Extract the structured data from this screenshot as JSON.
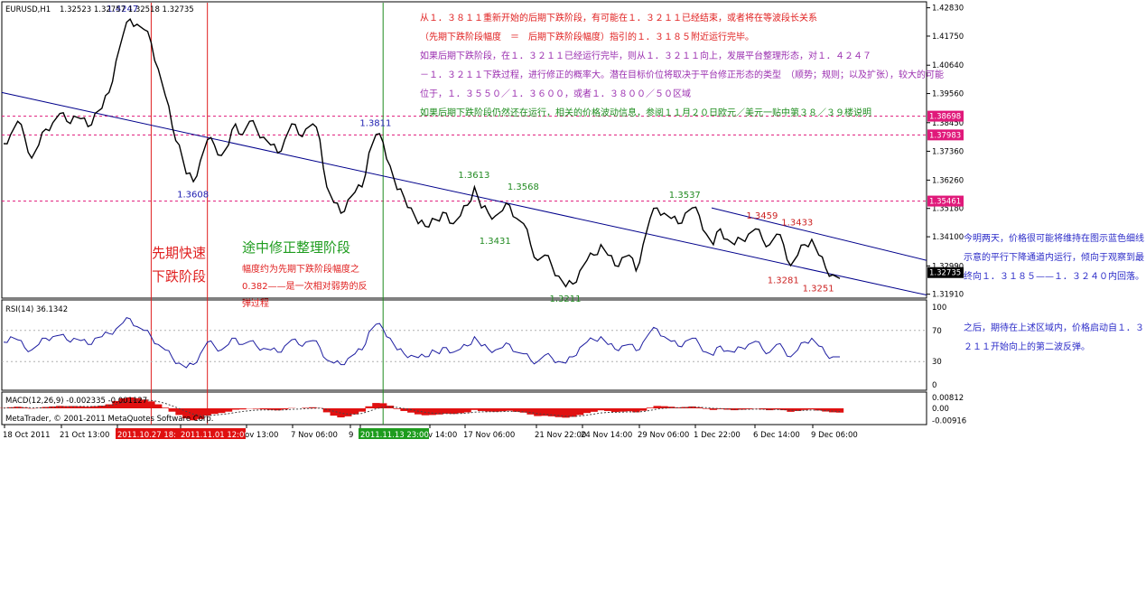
{
  "header": {
    "symbol": "EURUSD,H1",
    "ohlc": "1.32523 1.32757 1.32518 1.32735"
  },
  "chart_data": [
    {
      "type": "line",
      "title": "EURUSD,H1",
      "ylim": [
        1.3183,
        1.4292
      ],
      "y_ticks": [
        "1.42830",
        "1.41750",
        "1.40640",
        "1.39560",
        "1.38450",
        "1.37360",
        "1.36260",
        "1.35180",
        "1.34100",
        "1.32990",
        "1.31910"
      ],
      "price_tags": [
        {
          "label": "1.38698",
          "value": 1.38698,
          "color": "#e0197a"
        },
        {
          "label": "1.37983",
          "value": 1.37983,
          "color": "#e0197a"
        },
        {
          "label": "1.35461",
          "value": 1.35461,
          "color": "#e0197a"
        },
        {
          "label": "1.32735",
          "value": 1.32735,
          "color": "#000000"
        }
      ],
      "x_ticks": [
        "18 Oct 2011",
        "21 Oct 13:00",
        "2011.10.27 18:",
        "2011.11.01 12:00",
        "ov 13:00",
        "7 Nov 06:00",
        "9",
        "2011.11.13 23:00",
        "v 14:00",
        "17 Nov 06:00",
        "21 Nov 22:00",
        "24 Nov 14:00",
        "29 Nov 06:00",
        "1 Dec 22:00",
        "6 Dec 14:00",
        "9 Dec 06:00"
      ],
      "series": [
        {
          "color": "#000000",
          "values": [
            1.3765,
            1.38,
            1.385,
            1.379,
            1.371,
            1.376,
            1.382,
            1.3845,
            1.388,
            1.385,
            1.387,
            1.386,
            1.383,
            1.388,
            1.39,
            1.396,
            1.408,
            1.418,
            1.424,
            1.422,
            1.42,
            1.415,
            1.405,
            1.395,
            1.383,
            1.376,
            1.365,
            1.362,
            1.37,
            1.378,
            1.376,
            1.372,
            1.376,
            1.384,
            1.38,
            1.385,
            1.382,
            1.379,
            1.376,
            1.373,
            1.378,
            1.384,
            1.38,
            1.382,
            1.384,
            1.378,
            1.36,
            1.354,
            1.35,
            1.355,
            1.358,
            1.36,
            1.373,
            1.38,
            1.377,
            1.368,
            1.359,
            1.356,
            1.352,
            1.346,
            1.345,
            1.348,
            1.347,
            1.35,
            1.346,
            1.349,
            1.353,
            1.36,
            1.352,
            1.35,
            1.349,
            1.351,
            1.353,
            1.348,
            1.346,
            1.338,
            1.332,
            1.334,
            1.33,
            1.326,
            1.322,
            1.323,
            1.328,
            1.332,
            1.334,
            1.338,
            1.334,
            1.33,
            1.333,
            1.334,
            1.328,
            1.338,
            1.348,
            1.352,
            1.35,
            1.348,
            1.346,
            1.35,
            1.352,
            1.349,
            1.342,
            1.338,
            1.344,
            1.34,
            1.338,
            1.34,
            1.342,
            1.344,
            1.34,
            1.338,
            1.342,
            1.338,
            1.33,
            1.334,
            1.338,
            1.34,
            1.334,
            1.329,
            1.3265,
            1.3251
          ]
        }
      ],
      "trendlines": [
        {
          "name": "channel-lower",
          "color": "#00008b",
          "points": [
            [
              0,
              1.396
            ],
            [
              1024,
              1.3188
            ]
          ]
        },
        {
          "name": "channel-upper",
          "color": "#00008b",
          "points": [
            [
              786,
              1.352
            ],
            [
              1024,
              1.332
            ]
          ]
        }
      ],
      "annotations": [
        {
          "text": "1.4247",
          "color": "#1c1cb0",
          "value": 1.4247,
          "index": 17
        },
        {
          "text": "1.3608",
          "color": "#1c1cb0",
          "value": 1.3608,
          "index": 27
        },
        {
          "text": "1.3811",
          "color": "#1c1cb0",
          "value": 1.3811,
          "index": 53
        },
        {
          "text": "1.3613",
          "color": "#228b22",
          "value": 1.3613,
          "index": 67
        },
        {
          "text": "1.3568",
          "color": "#228b22",
          "value": 1.3568,
          "index": 74
        },
        {
          "text": "1.3431",
          "color": "#228b22",
          "value": 1.3431,
          "index": 70
        },
        {
          "text": "1.3211",
          "color": "#228b22",
          "value": 1.3211,
          "index": 80
        },
        {
          "text": "1.3537",
          "color": "#228b22",
          "value": 1.3537,
          "index": 97
        },
        {
          "text": "1.3459",
          "color": "#cc2222",
          "value": 1.3459,
          "index": 108
        },
        {
          "text": "1.3433",
          "color": "#cc2222",
          "value": 1.3433,
          "index": 113
        },
        {
          "text": "1.3281",
          "color": "#cc2222",
          "value": 1.3281,
          "index": 111
        },
        {
          "text": "1.3251",
          "color": "#cc2222",
          "value": 1.3251,
          "index": 116
        }
      ],
      "vertical_markers": [
        {
          "name": "marker-1",
          "color": "#e02020",
          "index": 21
        },
        {
          "name": "marker-2",
          "color": "#e02020",
          "index": 29
        },
        {
          "name": "marker-3",
          "color": "#1e8c1e",
          "index": 54
        }
      ]
    },
    {
      "type": "line",
      "title": "RSI(14) 36.1342",
      "ylim": [
        0,
        100
      ],
      "y_ticks": [
        "100",
        "70",
        "30",
        "0"
      ],
      "levels": [
        70,
        30
      ],
      "series": [
        {
          "color": "#1c1ca0",
          "values": [
            55,
            62,
            58,
            48,
            45,
            52,
            60,
            62,
            64,
            58,
            60,
            57,
            52,
            60,
            62,
            66,
            72,
            80,
            85,
            75,
            70,
            62,
            52,
            45,
            35,
            28,
            22,
            26,
            40,
            55,
            50,
            45,
            52,
            60,
            52,
            56,
            50,
            47,
            45,
            42,
            50,
            58,
            52,
            55,
            57,
            48,
            32,
            28,
            26,
            34,
            40,
            45,
            68,
            78,
            72,
            60,
            45,
            40,
            38,
            35,
            36,
            45,
            40,
            48,
            42,
            46,
            50,
            62,
            50,
            46,
            45,
            48,
            52,
            42,
            40,
            32,
            30,
            38,
            35,
            30,
            28,
            36,
            48,
            55,
            58,
            62,
            52,
            46,
            50,
            52,
            44,
            55,
            68,
            72,
            62,
            56,
            50,
            56,
            60,
            52,
            42,
            38,
            50,
            44,
            42,
            48,
            52,
            56,
            46,
            42,
            52,
            46,
            36,
            45,
            55,
            60,
            50,
            40,
            36,
            36
          ]
        }
      ]
    },
    {
      "type": "bar",
      "title": "MACD(12,26,9) -0.002335 -0.001127",
      "ylim": [
        -0.0115,
        0.0095
      ],
      "y_ticks": [
        "0.00812",
        "0.00",
        "-0.00916"
      ],
      "series": [
        {
          "color": "#e01010",
          "values": [
            0.0002,
            0.0008,
            0.0012,
            0.0006,
            -0.0002,
            0.0003,
            0.001,
            0.0014,
            0.0018,
            0.0016,
            0.0017,
            0.0015,
            0.0012,
            0.0016,
            0.002,
            0.003,
            0.0055,
            0.0075,
            0.0082,
            0.0076,
            0.0066,
            0.0052,
            0.003,
            0.0005,
            -0.0025,
            -0.005,
            -0.0075,
            -0.009,
            -0.008,
            -0.0055,
            -0.0042,
            -0.0035,
            -0.0025,
            -0.001,
            -0.0008,
            -0.0002,
            -0.0004,
            -0.0008,
            -0.0012,
            -0.0015,
            -0.0008,
            0.0002,
            0.0,
            0.0004,
            0.0008,
            0.0002,
            -0.003,
            -0.0055,
            -0.0068,
            -0.006,
            -0.0045,
            -0.0025,
            0.0015,
            0.004,
            0.0038,
            0.002,
            -0.0005,
            -0.002,
            -0.0032,
            -0.0045,
            -0.0052,
            -0.005,
            -0.0046,
            -0.004,
            -0.0042,
            -0.0036,
            -0.003,
            -0.0012,
            -0.002,
            -0.0024,
            -0.0026,
            -0.0022,
            -0.0018,
            -0.0026,
            -0.0032,
            -0.0046,
            -0.0058,
            -0.0056,
            -0.006,
            -0.0066,
            -0.007,
            -0.0064,
            -0.005,
            -0.0035,
            -0.0026,
            -0.0015,
            -0.002,
            -0.0028,
            -0.0025,
            -0.0022,
            -0.003,
            -0.0018,
            0.0005,
            0.0018,
            0.0016,
            0.0012,
            0.0006,
            0.001,
            0.0014,
            0.0008,
            -0.0004,
            -0.0012,
            -0.0006,
            -0.001,
            -0.0014,
            -0.001,
            -0.0006,
            -0.0002,
            -0.0008,
            -0.0014,
            -0.0008,
            -0.0014,
            -0.0026,
            -0.002,
            -0.0012,
            -0.0008,
            -0.0016,
            -0.0024,
            -0.003,
            -0.0032
          ]
        }
      ],
      "signal_color": "#444444"
    }
  ],
  "chart_text": {
    "phase1": [
      "先期快速",
      "下跌阶段"
    ],
    "phase2_title": "途中修正整理阶段",
    "phase2_desc": [
      "幅度约为先期下跌阶段幅度之",
      "0.382——是一次相对弱势的反",
      "弹过程"
    ],
    "copyright": "MetaTrader, © 2001-2011 MetaQuotes Software Corp."
  },
  "notes": {
    "line1": "从１．３８１１重新开始的后期下跌阶段，有可能在１．３２１１已经结束，或者将在等波段长关系",
    "line2": "（先期下跌阶段幅度　＝　后期下跌阶段幅度）指引的１．３１８５附近运行完毕。",
    "line3": "如果后期下跌阶段，在１．３２１１已经运行完毕，则从１．３２１１向上，发展平台整理形态，对１．４２４７",
    "line4": "－１．３２１１下跌过程，进行修正的概率大。潜在目标价位将取决于平台修正形态的类型　（顺势；规则；以及扩张），较大的可能",
    "line5": "位于，１．３５５０／１．３６００，或者１．３８００／５０区域",
    "line6": "如果后期下跌阶段仍然还在运行，相关的价格波动信息，参阅１１月２０日欧元／美元一贴中第３８／３９楼说明"
  },
  "side_notes": {
    "para1": "今明两天，价格很可能将维持在图示蓝色细线示意的平行下降通道内运行，倾向于观察到最终向１．３１８５——１．３２４０内回落。",
    "para2": "之后，期待在上述区域内，价格启动自１．３２１１开始向上的第二波反弹。"
  }
}
